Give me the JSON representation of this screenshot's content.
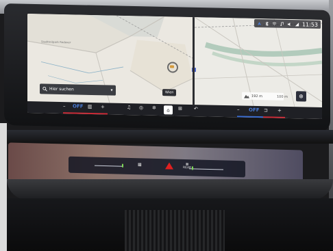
{
  "status": {
    "time": "11:53"
  },
  "map": {
    "place_label": "Stadtteilpark Rodaxer",
    "search_placeholder": "Hier suchen",
    "tooltip": "Wien",
    "scale_label": "192 m",
    "distance_label": "100 m"
  },
  "climate": {
    "left_minus": "–",
    "left_status": "OFF",
    "left_plus": "+",
    "right_minus": "–",
    "right_status": "OFF",
    "right_plus": "+"
  },
  "lower_panel": {
    "rear_label": "REAR"
  },
  "colors": {
    "accent_blue": "#4b7dd8",
    "accent_red": "#cc2a36",
    "hazard_red": "#e02020",
    "level_green": "#7ed957"
  }
}
